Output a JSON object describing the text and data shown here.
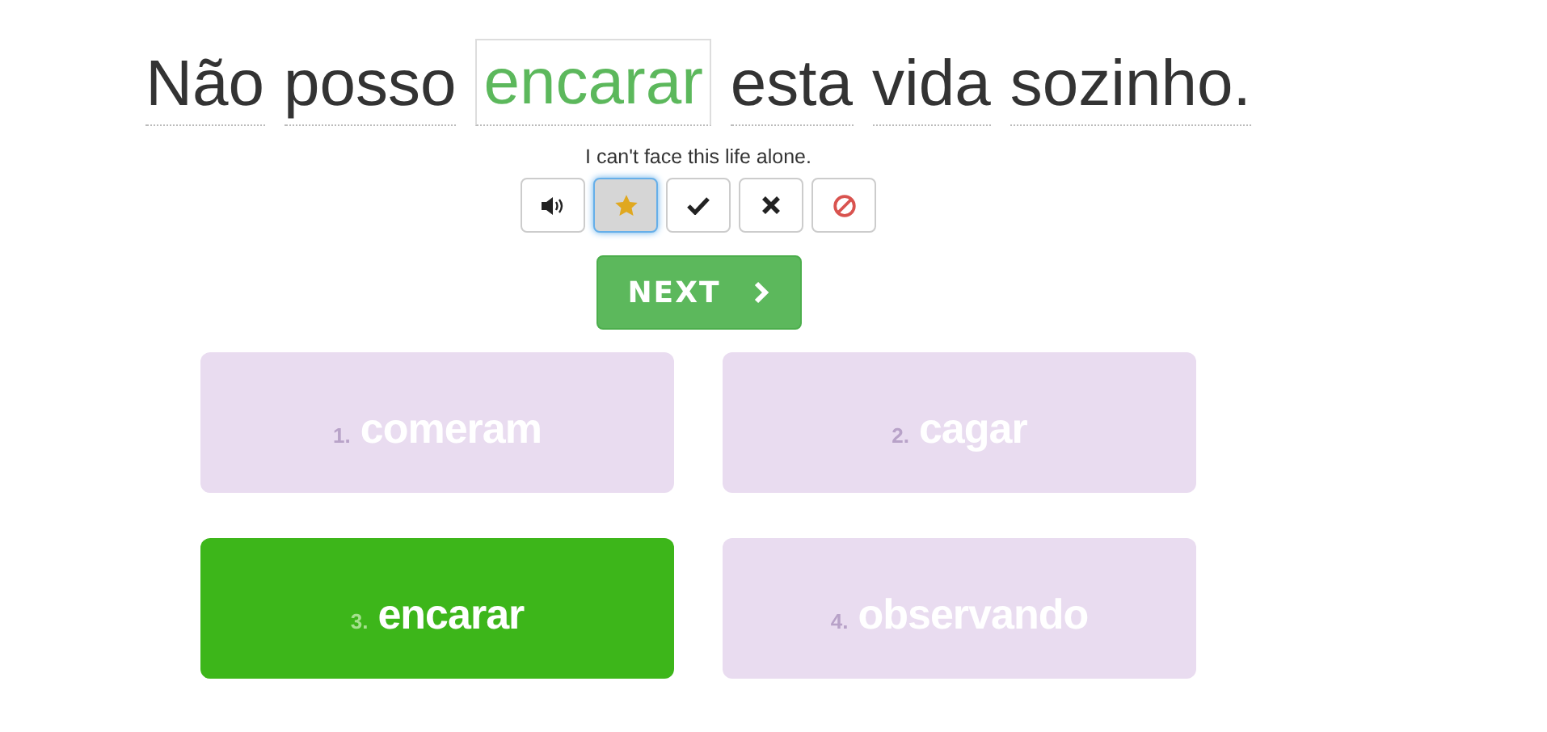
{
  "sentence": [
    {
      "text": "Não",
      "kind": "word"
    },
    {
      "text": "posso",
      "kind": "word"
    },
    {
      "text": "encarar",
      "kind": "answer"
    },
    {
      "text": "esta",
      "kind": "word"
    },
    {
      "text": "vida",
      "kind": "word"
    },
    {
      "text": "sozinho.",
      "kind": "word"
    }
  ],
  "translation": "I can't face this life alone.",
  "tools": [
    {
      "kind": "speaker",
      "selected": false
    },
    {
      "kind": "star",
      "selected": true
    },
    {
      "kind": "check",
      "selected": false
    },
    {
      "kind": "cross",
      "selected": false
    },
    {
      "kind": "ban",
      "selected": false
    }
  ],
  "next_button": "NEXT",
  "options": [
    {
      "number": "1.",
      "text": "comeram",
      "selected": false
    },
    {
      "number": "2.",
      "text": "cagar",
      "selected": false
    },
    {
      "number": "3.",
      "text": "encarar",
      "selected": true
    },
    {
      "number": "4.",
      "text": "observando",
      "selected": false
    }
  ]
}
